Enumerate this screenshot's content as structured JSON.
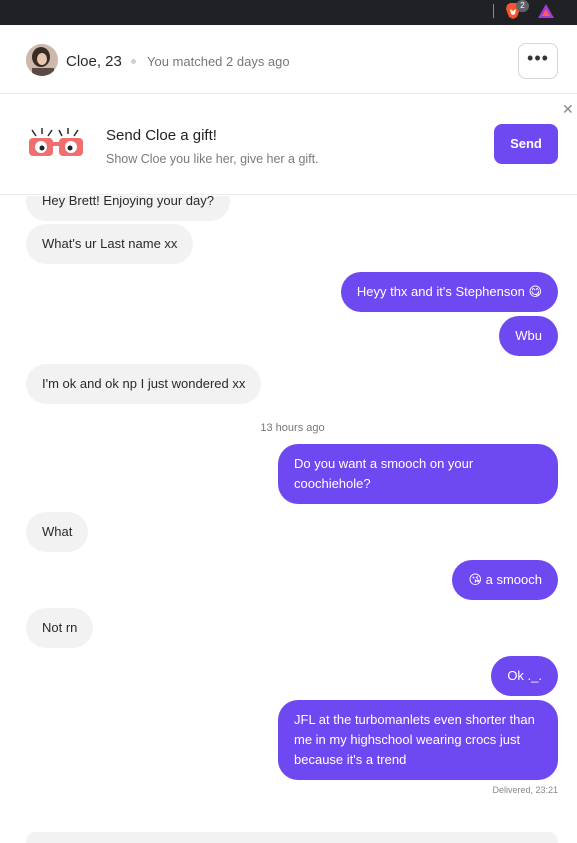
{
  "browser": {
    "badge_count": "2",
    "brave_icon": "brave-lion-icon",
    "rewards_icon": "triangle-rewards-icon"
  },
  "header": {
    "name": "Cloe, 23",
    "matched": "You matched 2 days ago",
    "more_label": "•••"
  },
  "gift": {
    "title": "Send Cloe a gift!",
    "subtitle": "Show Cloe you like her, give her a gift.",
    "send_label": "Send",
    "close_label": "✕"
  },
  "messages": [
    {
      "from": "them",
      "text": "Hey Brett! Enjoying your day?"
    },
    {
      "from": "them",
      "text": "What's ur Last name xx"
    },
    {
      "from": "me",
      "text": "Heyy thx and it's Stephenson 😋"
    },
    {
      "from": "me",
      "text": "Wbu"
    },
    {
      "from": "them",
      "text": "I'm ok and ok np I just wondered xx"
    },
    {
      "from": "me",
      "text": "Do you want a smooch on your coochiehole?"
    },
    {
      "from": "them",
      "text": "What"
    },
    {
      "from": "me",
      "text": "😘 a smooch"
    },
    {
      "from": "them",
      "text": "Not rn"
    },
    {
      "from": "me",
      "text": "Ok ._."
    },
    {
      "from": "me",
      "text": "JFL at the turbomanlets even shorter than me in my highschool wearing crocs just because it's a trend"
    }
  ],
  "timestamp": "13 hours ago",
  "delivered": "Delivered, 23:21",
  "colors": {
    "accent": "#6e48f1",
    "incoming_bg": "#f2f2f2"
  }
}
